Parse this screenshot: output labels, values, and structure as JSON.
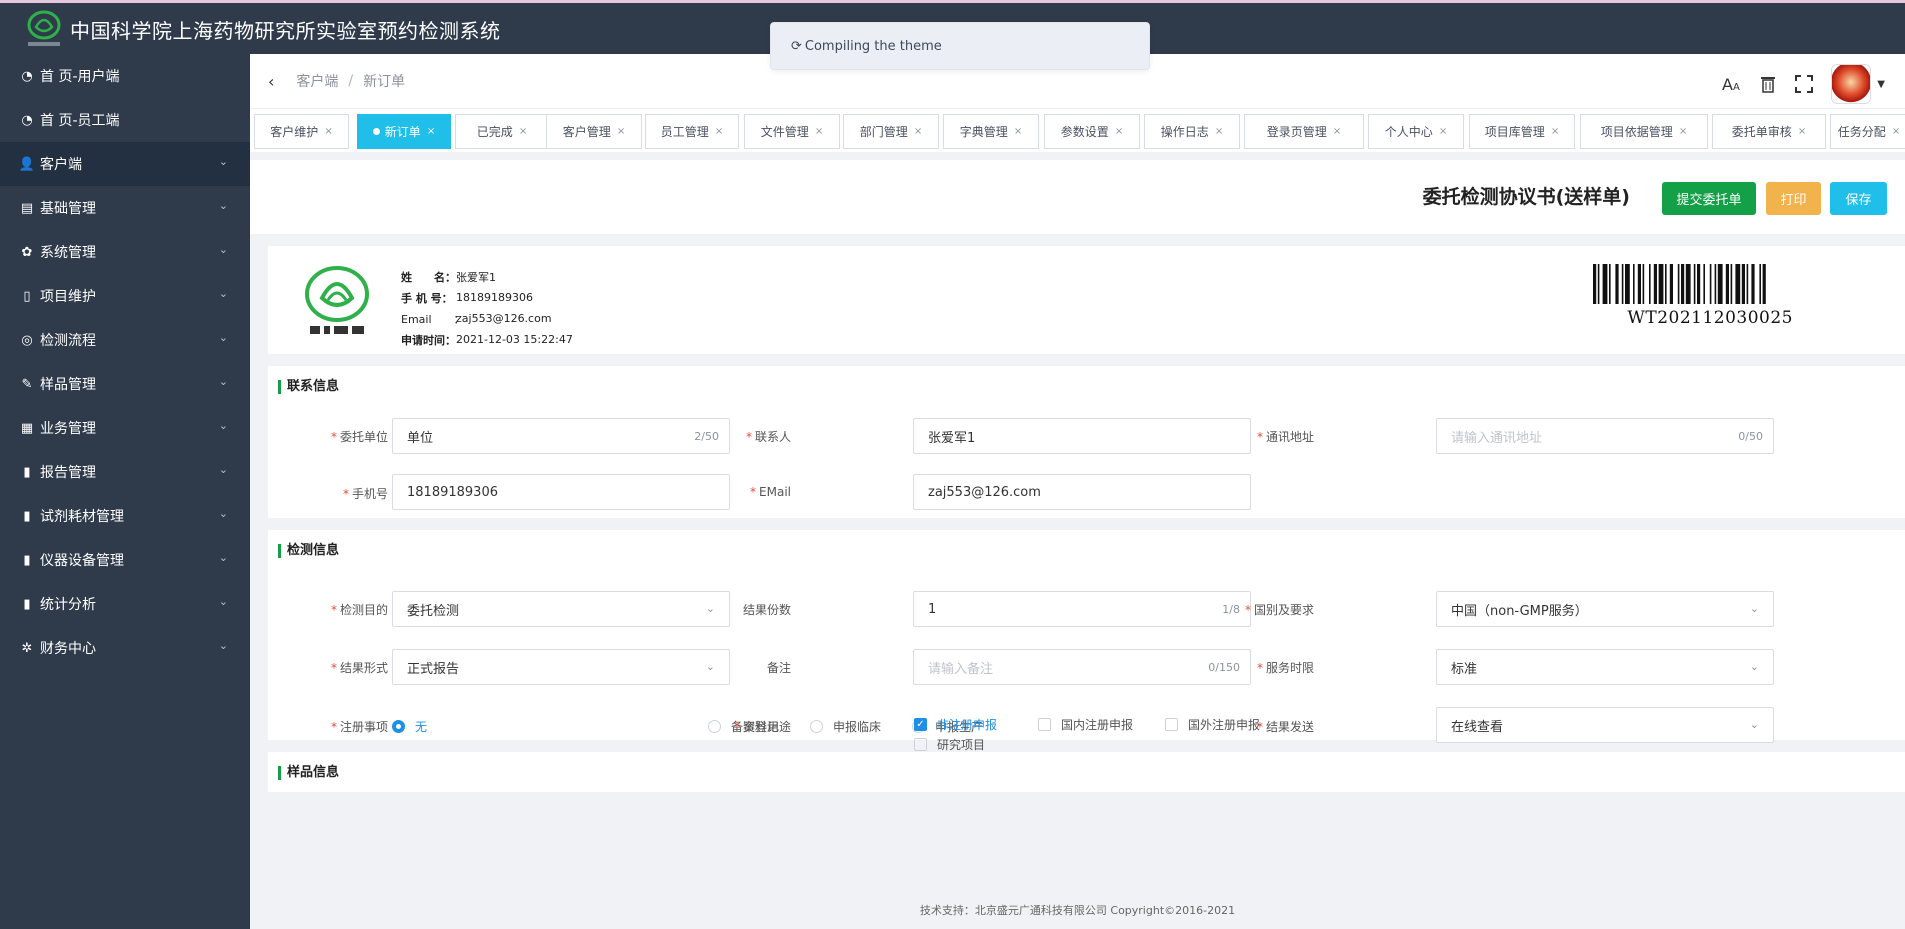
{
  "app": {
    "title": "中国科学院上海药物研究所实验室预约检测系统",
    "toast": "Compiling the theme"
  },
  "sidebar": {
    "items": [
      {
        "label": "首 页-用户端",
        "icon": "dashboard-icon"
      },
      {
        "label": "首 页-员工端",
        "icon": "dashboard-icon"
      },
      {
        "label": "客户端",
        "icon": "user-icon"
      },
      {
        "label": "基础管理",
        "icon": "server-icon"
      },
      {
        "label": "系统管理",
        "icon": "gear-icon"
      },
      {
        "label": "项目维护",
        "icon": "book-icon"
      },
      {
        "label": "检测流程",
        "icon": "flow-icon"
      },
      {
        "label": "样品管理",
        "icon": "edit-icon"
      },
      {
        "label": "业务管理",
        "icon": "grid-icon"
      },
      {
        "label": "报告管理",
        "icon": "info-icon"
      },
      {
        "label": "试剂耗材管理",
        "icon": "info-icon"
      },
      {
        "label": "仪器设备管理",
        "icon": "info-icon"
      },
      {
        "label": "统计分析",
        "icon": "info-icon"
      },
      {
        "label": "财务中心",
        "icon": "lifebuoy-icon"
      }
    ]
  },
  "breadcrumb": {
    "back": "‹",
    "items": [
      "客户端",
      "新订单"
    ],
    "sep": "/"
  },
  "tabs": [
    {
      "label": "客户维护"
    },
    {
      "label": "新订单",
      "active": true
    },
    {
      "label": "已完成"
    },
    {
      "label": "客户管理"
    },
    {
      "label": "员工管理"
    },
    {
      "label": "文件管理"
    },
    {
      "label": "部门管理"
    },
    {
      "label": "字典管理"
    },
    {
      "label": "参数设置"
    },
    {
      "label": "操作日志"
    },
    {
      "label": "登录页管理"
    },
    {
      "label": "个人中心"
    },
    {
      "label": "项目库管理"
    },
    {
      "label": "项目依据管理"
    },
    {
      "label": "委托单审核"
    },
    {
      "label": "任务分配"
    }
  ],
  "page": {
    "title": "委托检测协议书(送样单)",
    "buttons": {
      "submit": "提交委托单",
      "print": "打印",
      "save": "保存"
    }
  },
  "applicant": {
    "rows": [
      {
        "key": "姓　　名：",
        "value": "张爱军1"
      },
      {
        "key": "手 机 号：",
        "value": "18189189306"
      },
      {
        "key": "Email　　：",
        "value": "zaj553@126.com"
      },
      {
        "key": "申请时间：",
        "value": "2021-12-03 15:22:47"
      }
    ],
    "barcode": "WT202112030025"
  },
  "contact": {
    "title": "联系信息",
    "unit_label": "委托单位",
    "unit_value": "单位",
    "unit_count": "2/50",
    "person_label": "联系人",
    "person_value": "张爱军1",
    "address_label": "通讯地址",
    "address_placeholder": "请输入通讯地址",
    "address_count": "0/50",
    "phone_label": "手机号",
    "phone_value": "18189189306",
    "email_label": "EMail",
    "email_value": "zaj553@126.com"
  },
  "detect": {
    "title": "检测信息",
    "purpose_label": "检测目的",
    "purpose_value": "委托检测",
    "copies_label": "结果份数",
    "copies_value": "1",
    "copies_count": "1/8",
    "country_label": "国别及要求",
    "country_value": "中国（non-GMP服务）",
    "format_label": "结果形式",
    "format_value": "正式报告",
    "remark_label": "备注",
    "remark_placeholder": "请输入备注",
    "remark_count": "0/150",
    "service_label": "服务时限",
    "service_value": "标准",
    "reg_label": "注册事项",
    "reg_options": [
      "无",
      "备案登记",
      "申报临床",
      "申报生产"
    ],
    "reg_selected": "无",
    "usage_label": "资料用途",
    "usage_options": [
      "非注册申报",
      "国内注册申报",
      "国外注册申报",
      "研究项目"
    ],
    "usage_checked": [
      "非注册申报"
    ],
    "send_label": "结果发送",
    "send_value": "在线查看"
  },
  "sample": {
    "title": "样品信息"
  },
  "footer": "技术支持：北京盛元广通科技有限公司 Copyright©2016-2021"
}
